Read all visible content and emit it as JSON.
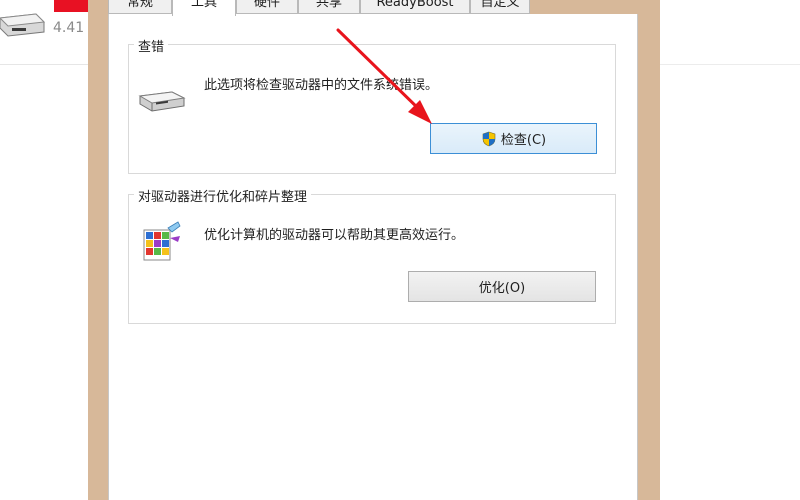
{
  "background": {
    "drive_size_text": "4.41"
  },
  "tabs": [
    {
      "label": "常规",
      "active": false
    },
    {
      "label": "工具",
      "active": true
    },
    {
      "label": "硬件",
      "active": false
    },
    {
      "label": "共享",
      "active": false
    },
    {
      "label": "ReadyBoost",
      "active": false
    },
    {
      "label": "自定义",
      "active": false
    }
  ],
  "error_checking": {
    "title": "查错",
    "description": "此选项将检查驱动器中的文件系统错误。",
    "button_label": "检查(C)"
  },
  "optimize": {
    "title": "对驱动器进行优化和碎片整理",
    "description": "优化计算机的驱动器可以帮助其更高效运行。",
    "button_label": "优化(O)"
  },
  "colors": {
    "frame": "#d7b899",
    "annotation_arrow": "#e8141c",
    "focus_border": "#3c8fd6"
  }
}
